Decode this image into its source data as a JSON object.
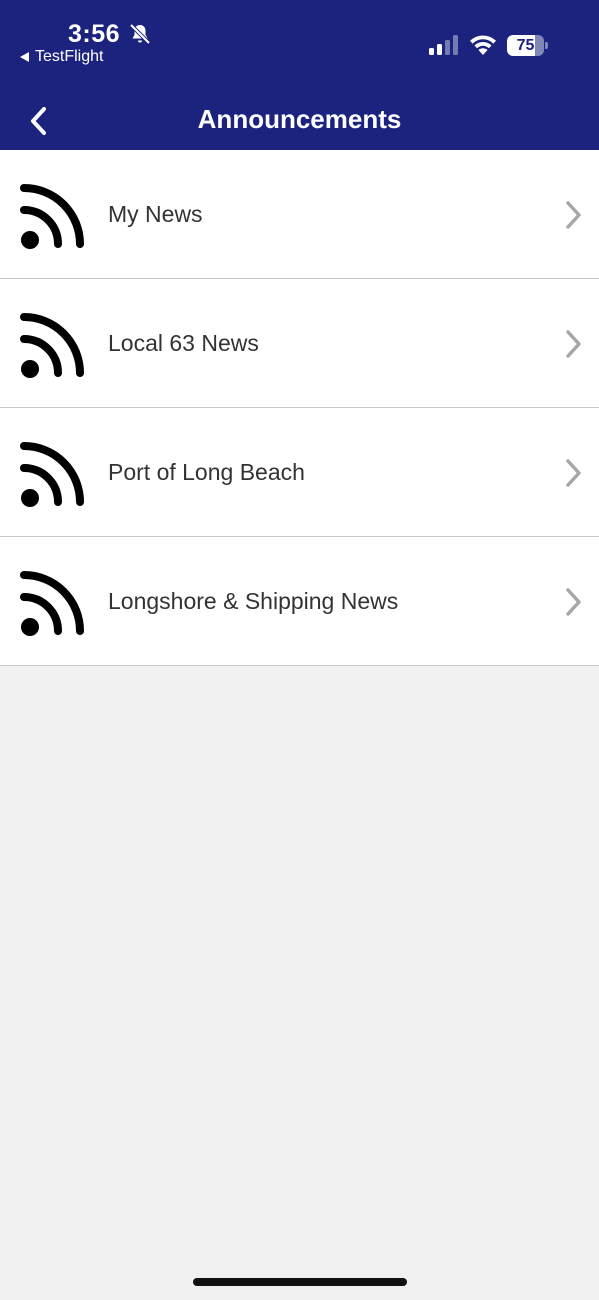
{
  "status_bar": {
    "time": "3:56",
    "back_app": "TestFlight",
    "battery": "75",
    "battery_level": 0.75
  },
  "nav": {
    "title": "Announcements"
  },
  "items": [
    {
      "label": "My News"
    },
    {
      "label": "Local 63 News"
    },
    {
      "label": "Port of Long Beach"
    },
    {
      "label": "Longshore & Shipping News"
    }
  ],
  "colors": {
    "header_bg": "#1b237f",
    "list_bg": "#ffffff",
    "page_bg": "#f1f1f1",
    "chevron": "#a7a7a7"
  },
  "icons": {
    "item": "rss-feed-icon",
    "row_arrow": "chevron-right-icon",
    "back": "chevron-left-icon",
    "silent": "bell-slash-icon"
  }
}
